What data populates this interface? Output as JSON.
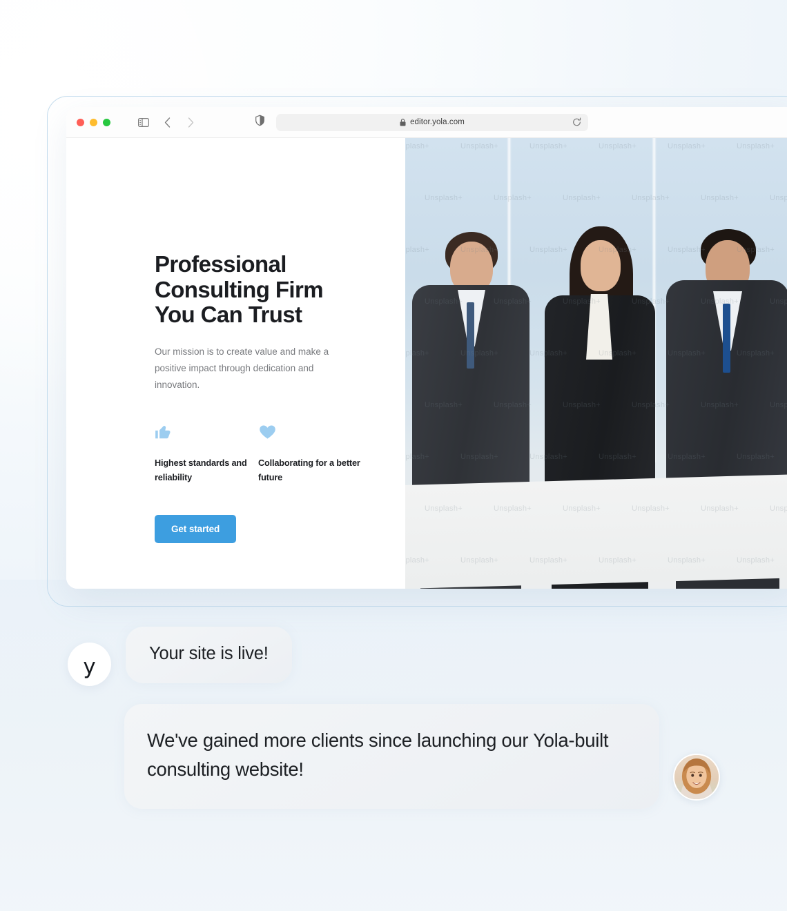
{
  "browser": {
    "traffic_lights": [
      "close",
      "minimize",
      "maximize"
    ],
    "sidebar_toggle_icon": "sidebar-toggle-icon",
    "back_icon": "chevron-left-icon",
    "forward_icon": "chevron-right-icon",
    "shield_icon": "shield-icon",
    "lock_icon": "lock-icon",
    "url": "editor.yola.com",
    "reload_icon": "reload-icon"
  },
  "site": {
    "hero": {
      "title": "Professional Consulting Firm You Can Trust",
      "subtitle": "Our mission is to create value and make a positive impact through dedication and innovation.",
      "cta_label": "Get started",
      "features": [
        {
          "icon": "thumbs-up-icon",
          "label": "Highest standards and reliability"
        },
        {
          "icon": "heart-icon",
          "label": "Collaborating for a better future"
        }
      ]
    },
    "image": {
      "alt": "Three business professionals standing in an office",
      "watermark": "Unsplash+"
    }
  },
  "chat": {
    "messages": [
      {
        "avatar": "yola-logo-avatar",
        "avatar_letter": "y",
        "text": "Your site is live!"
      },
      {
        "avatar": "user-photo-avatar",
        "text": "We've gained more clients since launching our Yola-built consulting website!"
      }
    ]
  },
  "colors": {
    "accent": "#3d9ee0",
    "icon_light_blue": "#9ccdf0",
    "text_dark": "#1b1d21",
    "text_muted": "#77797d",
    "bubble_bg": "#f0f3f6",
    "frame_border": "#c5ddee"
  }
}
